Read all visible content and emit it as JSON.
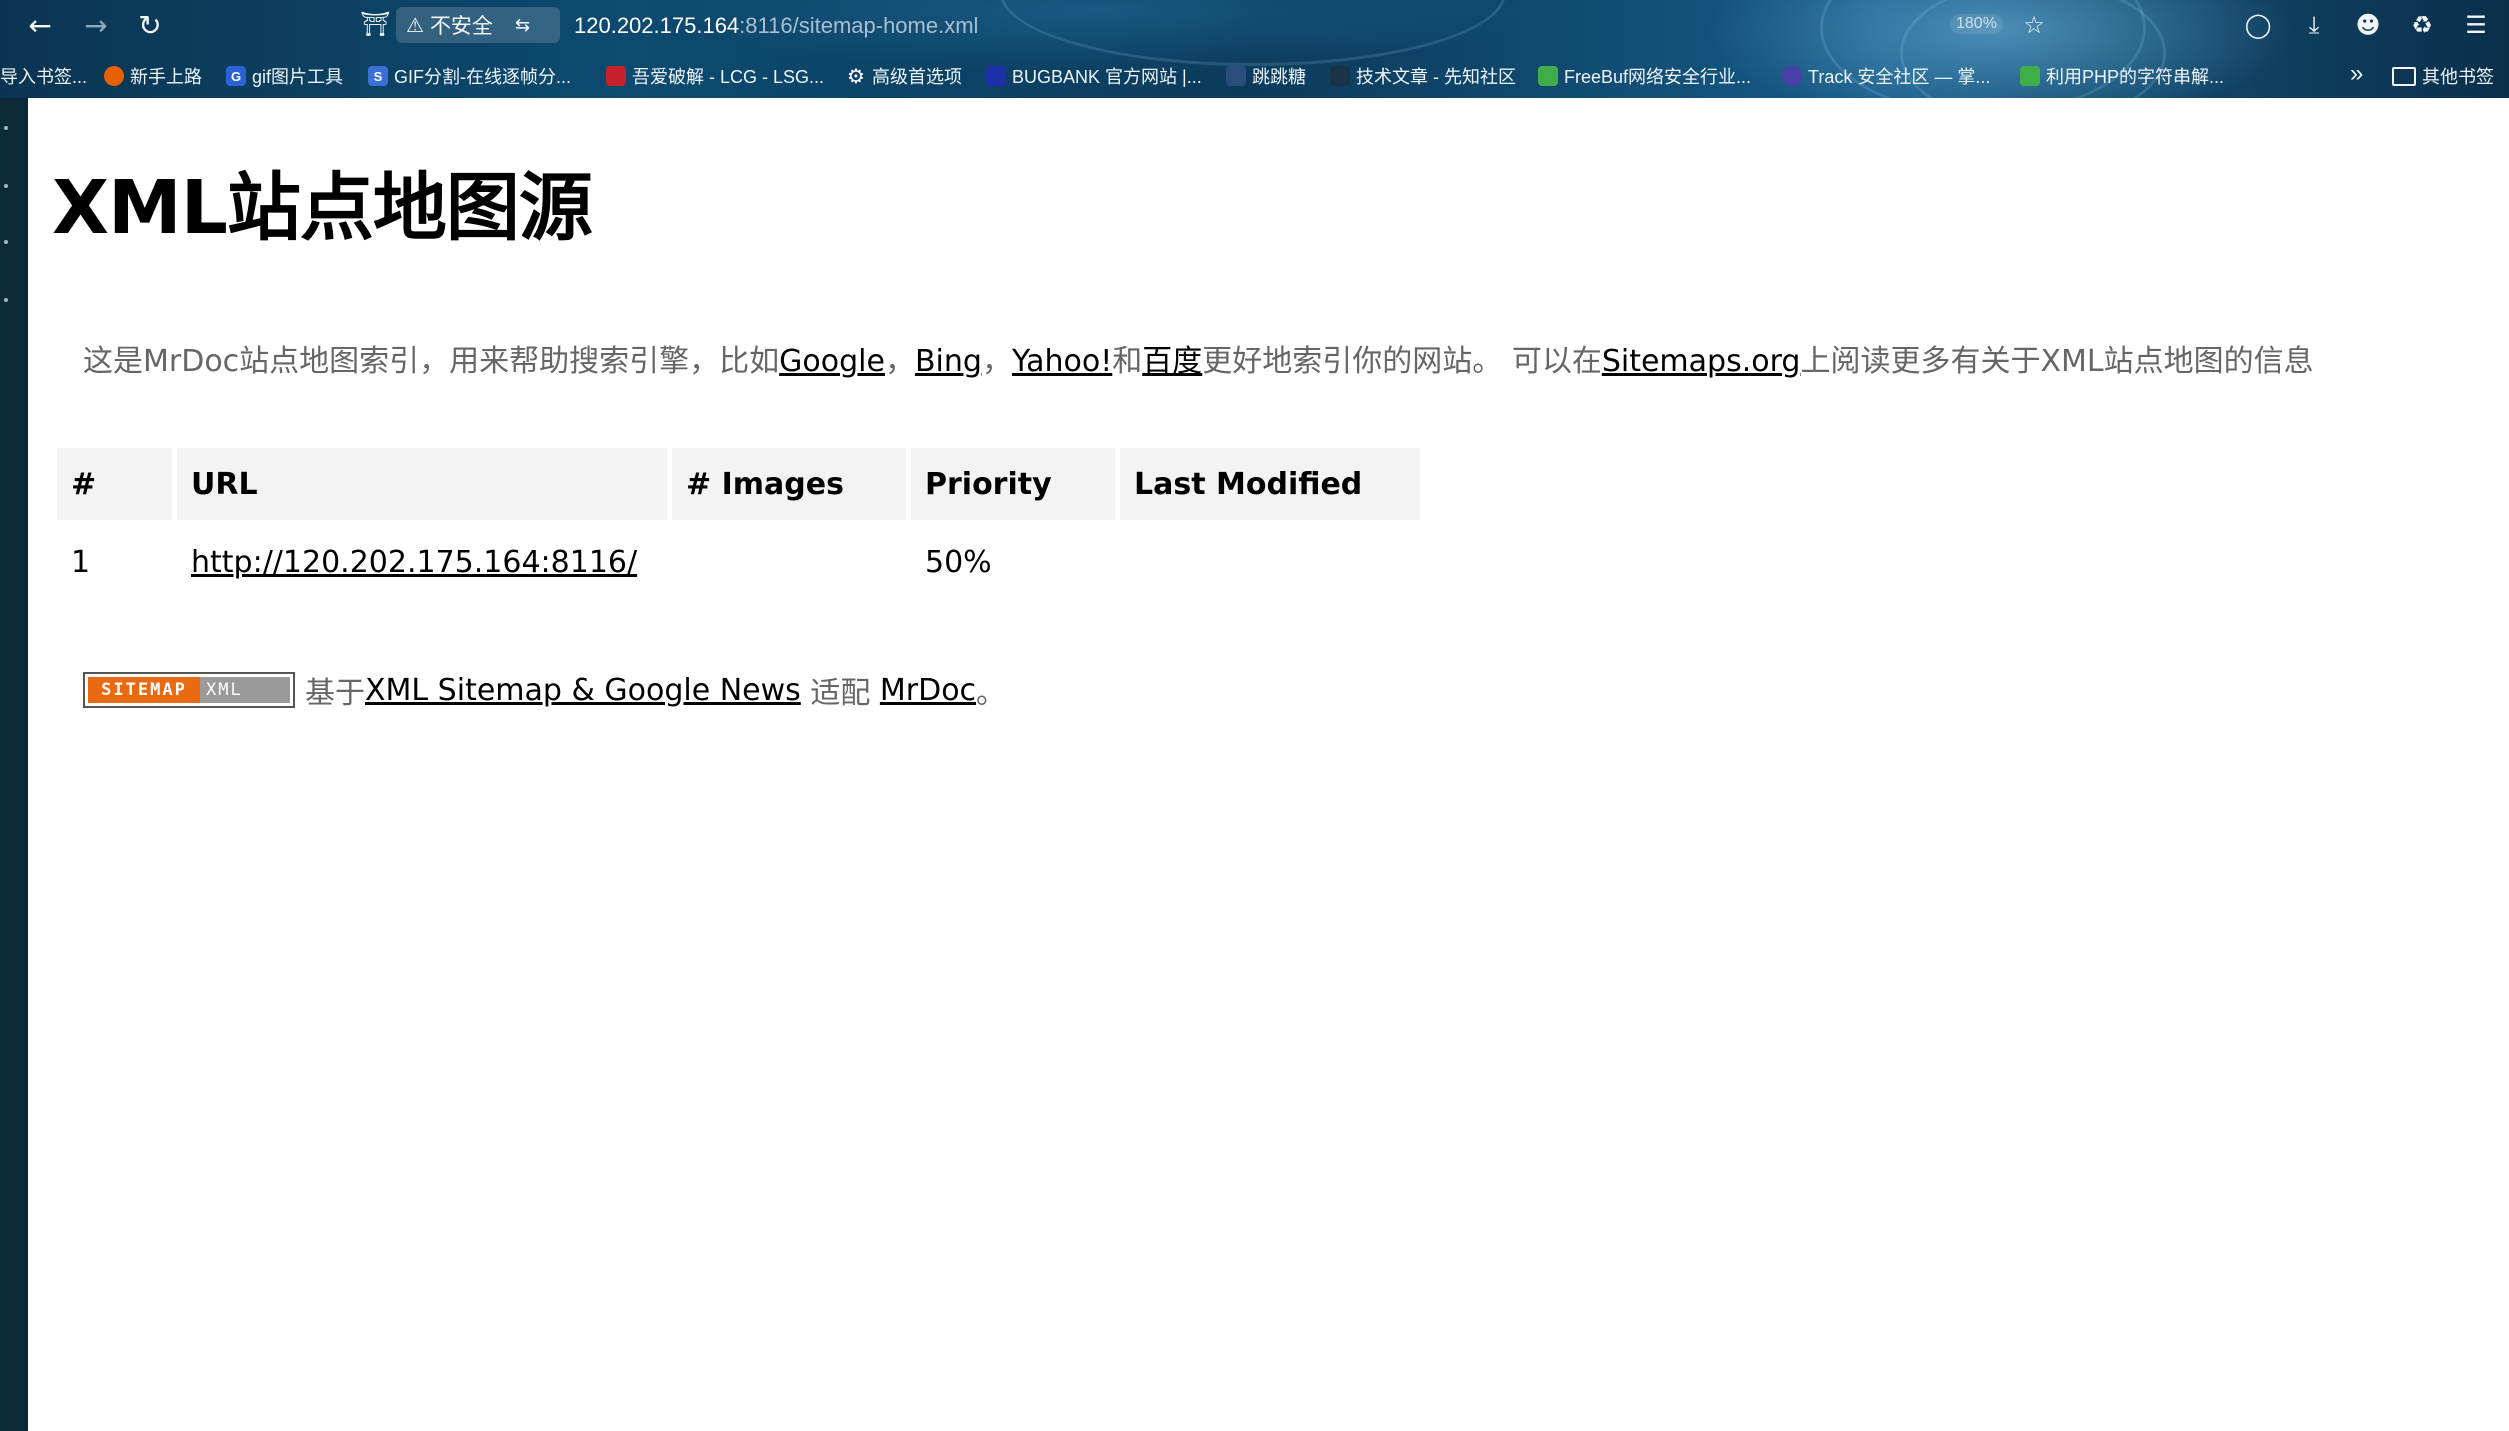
{
  "browser": {
    "url_host": "120.202.175.164",
    "url_rest": ":8116/sitemap-home.xml",
    "security_label": "不安全",
    "zoom_level": "180%",
    "bookmarks": [
      {
        "label": "导入书签..."
      },
      {
        "label": "新手上路"
      },
      {
        "label": "gif图片工具"
      },
      {
        "label": "GIF分割-在线逐帧分..."
      },
      {
        "label": "吾爱破解 - LCG - LSG..."
      },
      {
        "label": "高级首选项"
      },
      {
        "label": "BUGBANK 官方网站 |..."
      },
      {
        "label": "跳跳糖"
      },
      {
        "label": "技术文章 - 先知社区"
      },
      {
        "label": "FreeBuf网络安全行业..."
      },
      {
        "label": "Track 安全社区 — 掌..."
      },
      {
        "label": "利用PHP的字符串解..."
      }
    ],
    "other_bookmarks": "其他书签",
    "colors": {
      "chrome": "#0b3b5c",
      "accent": "#165a86"
    }
  },
  "page": {
    "title": "XML站点地图源",
    "intro": {
      "t1": "这是MrDoc站点地图索引，用来帮助搜索引擎，比如",
      "google": "Google",
      "sep1": "，",
      "bing": "Bing",
      "sep2": "，",
      "yahoo": "Yahoo!",
      "and": "和",
      "baidu": "百度",
      "t2": "更好地索引你的网站。 可以在",
      "sitemaps": "Sitemaps.org",
      "t3": "上阅读更多有关于XML站点地图的信息"
    },
    "table": {
      "headers": [
        "#",
        "URL",
        "# Images",
        "Priority",
        "Last Modified"
      ],
      "rows": [
        {
          "num": "1",
          "url": "http://120.202.175.164:8116/",
          "images": "",
          "priority": "50%",
          "last_modified": ""
        }
      ]
    },
    "footer": {
      "badge_left": "SITEMAP",
      "badge_right": "XML",
      "based_on": "基于",
      "plugin_link": "XML Sitemap & Google News",
      "adapted": " 适配 ",
      "mrdoc_link": "MrDoc",
      "end": "。"
    }
  }
}
